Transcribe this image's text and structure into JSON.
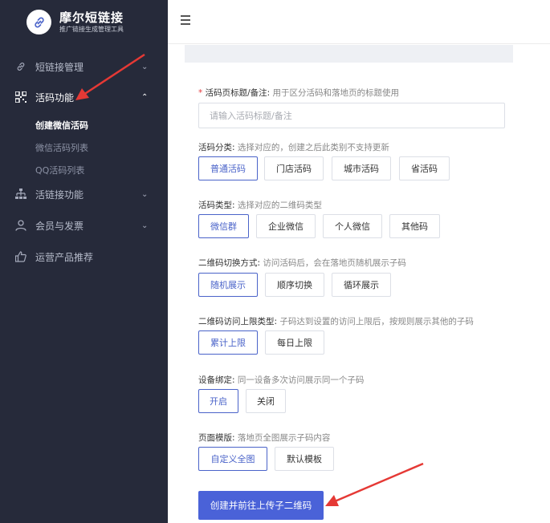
{
  "brand": {
    "title": "摩尔短链接",
    "subtitle": "推广链接生成管理工具"
  },
  "sidebar": {
    "items": [
      {
        "label": "短链接管理",
        "icon": "link-icon"
      },
      {
        "label": "活码功能",
        "icon": "qrcode-icon"
      },
      {
        "label": "活链接功能",
        "icon": "sitemap-icon"
      },
      {
        "label": "会员与发票",
        "icon": "user-icon"
      },
      {
        "label": "运营产品推荐",
        "icon": "thumbs-up-icon"
      }
    ],
    "sub_items": [
      "创建微信活码",
      "微信活码列表",
      "QQ活码列表"
    ]
  },
  "form": {
    "title_field": {
      "required_mark": "*",
      "label": "活码页标题/备注:",
      "hint": "用于区分活码和落地页的标题使用",
      "placeholder": "请输入活码标题/备注"
    },
    "category": {
      "label": "活码分类:",
      "hint": "选择对应的，创建之后此类别不支持更新",
      "options": [
        "普通活码",
        "门店活码",
        "城市活码",
        "省活码"
      ],
      "selected": "普通活码"
    },
    "type": {
      "label": "活码类型:",
      "hint": "选择对应的二维码类型",
      "options": [
        "微信群",
        "企业微信",
        "个人微信",
        "其他码"
      ],
      "selected": "微信群"
    },
    "switch_mode": {
      "label": "二维码切换方式:",
      "hint": "访问活码后，会在落地页随机展示子码",
      "options": [
        "随机展示",
        "顺序切换",
        "循环展示"
      ],
      "selected": "随机展示"
    },
    "limit_type": {
      "label": "二维码访问上限类型:",
      "hint": "子码达到设置的访问上限后，按规则展示其他的子码",
      "options": [
        "累计上限",
        "每日上限"
      ],
      "selected": "累计上限"
    },
    "device_bind": {
      "label": "设备绑定:",
      "hint": "同一设备多次访问展示同一个子码",
      "options": [
        "开启",
        "关闭"
      ],
      "selected": "开启"
    },
    "template": {
      "label": "页面模版:",
      "hint": "落地页全图展示子码内容",
      "options": [
        "自定义全图",
        "默认模板"
      ],
      "selected": "自定义全图"
    },
    "submit_label": "创建并前往上传子二维码"
  },
  "colors": {
    "sidebar_bg": "#262a3a",
    "accent": "#4a63c9",
    "primary_button": "#4a62d8",
    "annotation_arrow": "#e53935"
  }
}
